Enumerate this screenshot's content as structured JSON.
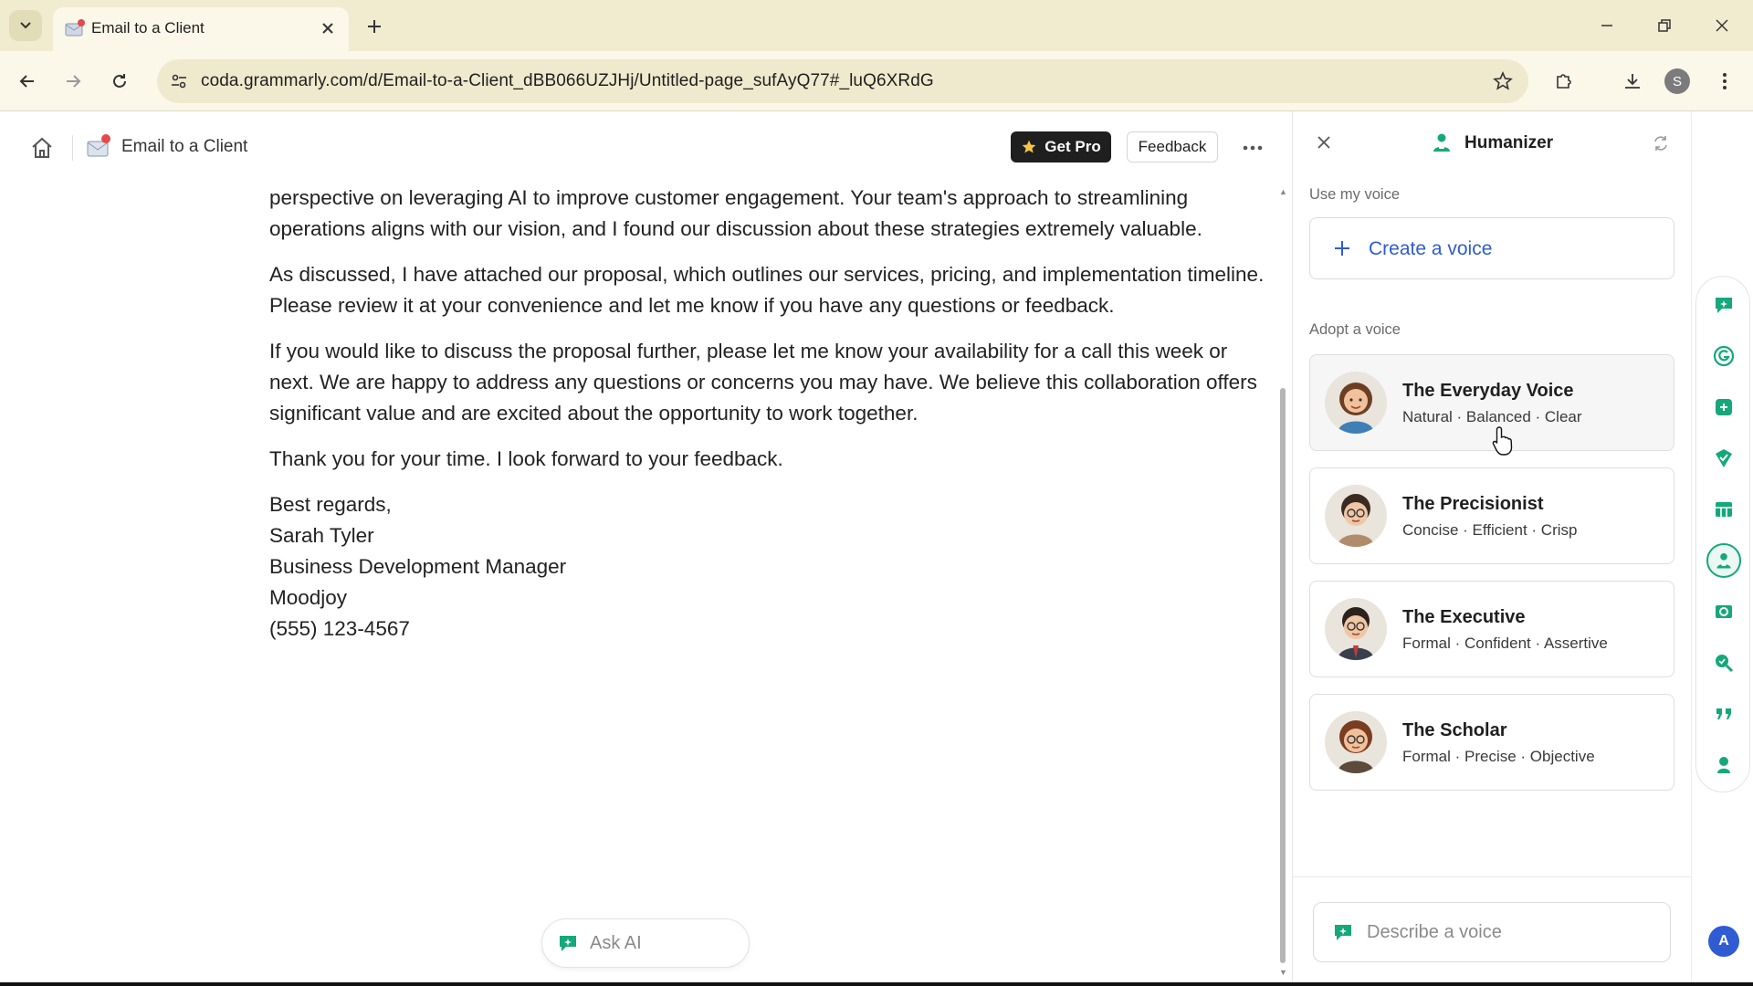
{
  "browser": {
    "tab_title": "Email to a Client",
    "url": "coda.grammarly.com/d/Email-to-a-Client_dBB066UZJHj/Untitled-page_sufAyQ77#_luQ6XRdG",
    "profile_initial": "S"
  },
  "doc_header": {
    "title": "Email to a Client",
    "get_pro_label": "Get Pro",
    "feedback_label": "Feedback"
  },
  "document": {
    "paragraphs": [
      "perspective on leveraging AI to improve customer engagement. Your team's approach to streamlining operations aligns with our vision, and I found our discussion about these strategies extremely valuable.",
      "As discussed, I have attached our proposal, which outlines our services, pricing, and implementation timeline. Please review it at your convenience and let me know if you have any questions or feedback.",
      "If you would like to discuss the proposal further, please let me know your availability for a call this week or next. We are happy to address any questions or concerns you may have. We believe this collaboration offers significant value and are excited about the opportunity to work together.",
      "Thank you for your time. I look forward to your feedback."
    ],
    "signature": [
      "Best regards,",
      "Sarah Tyler",
      "Business Development Manager",
      "Moodjoy",
      "(555) 123-4567"
    ],
    "ask_ai_label": "Ask AI"
  },
  "panel": {
    "title": "Humanizer",
    "use_my_voice_label": "Use my voice",
    "create_voice_label": "Create a voice",
    "adopt_voice_label": "Adopt a voice",
    "voices": [
      {
        "name": "The Everyday Voice",
        "tags": "Natural · Balanced · Clear"
      },
      {
        "name": "The Precisionist",
        "tags": "Concise · Efficient · Crisp"
      },
      {
        "name": "The Executive",
        "tags": "Formal · Confident · Assertive"
      },
      {
        "name": "The Scholar",
        "tags": "Formal · Precise · Objective"
      }
    ],
    "describe_placeholder": "Describe a voice"
  },
  "rail": {
    "account_initial": "A",
    "accent_color": "#15a87a",
    "icons": [
      "chat-icon",
      "grammarly-g-icon",
      "expand-icon",
      "check-shield-icon",
      "table-icon",
      "humanizer-icon",
      "scan-icon",
      "search-check-icon",
      "quote-icon",
      "person-stamp-icon"
    ]
  },
  "colors": {
    "tabbar_bg": "#f1ecd0",
    "toolbar_bg": "#fbf8ea",
    "link_blue": "#2f5bd3",
    "grammarly_green": "#15a87a"
  }
}
